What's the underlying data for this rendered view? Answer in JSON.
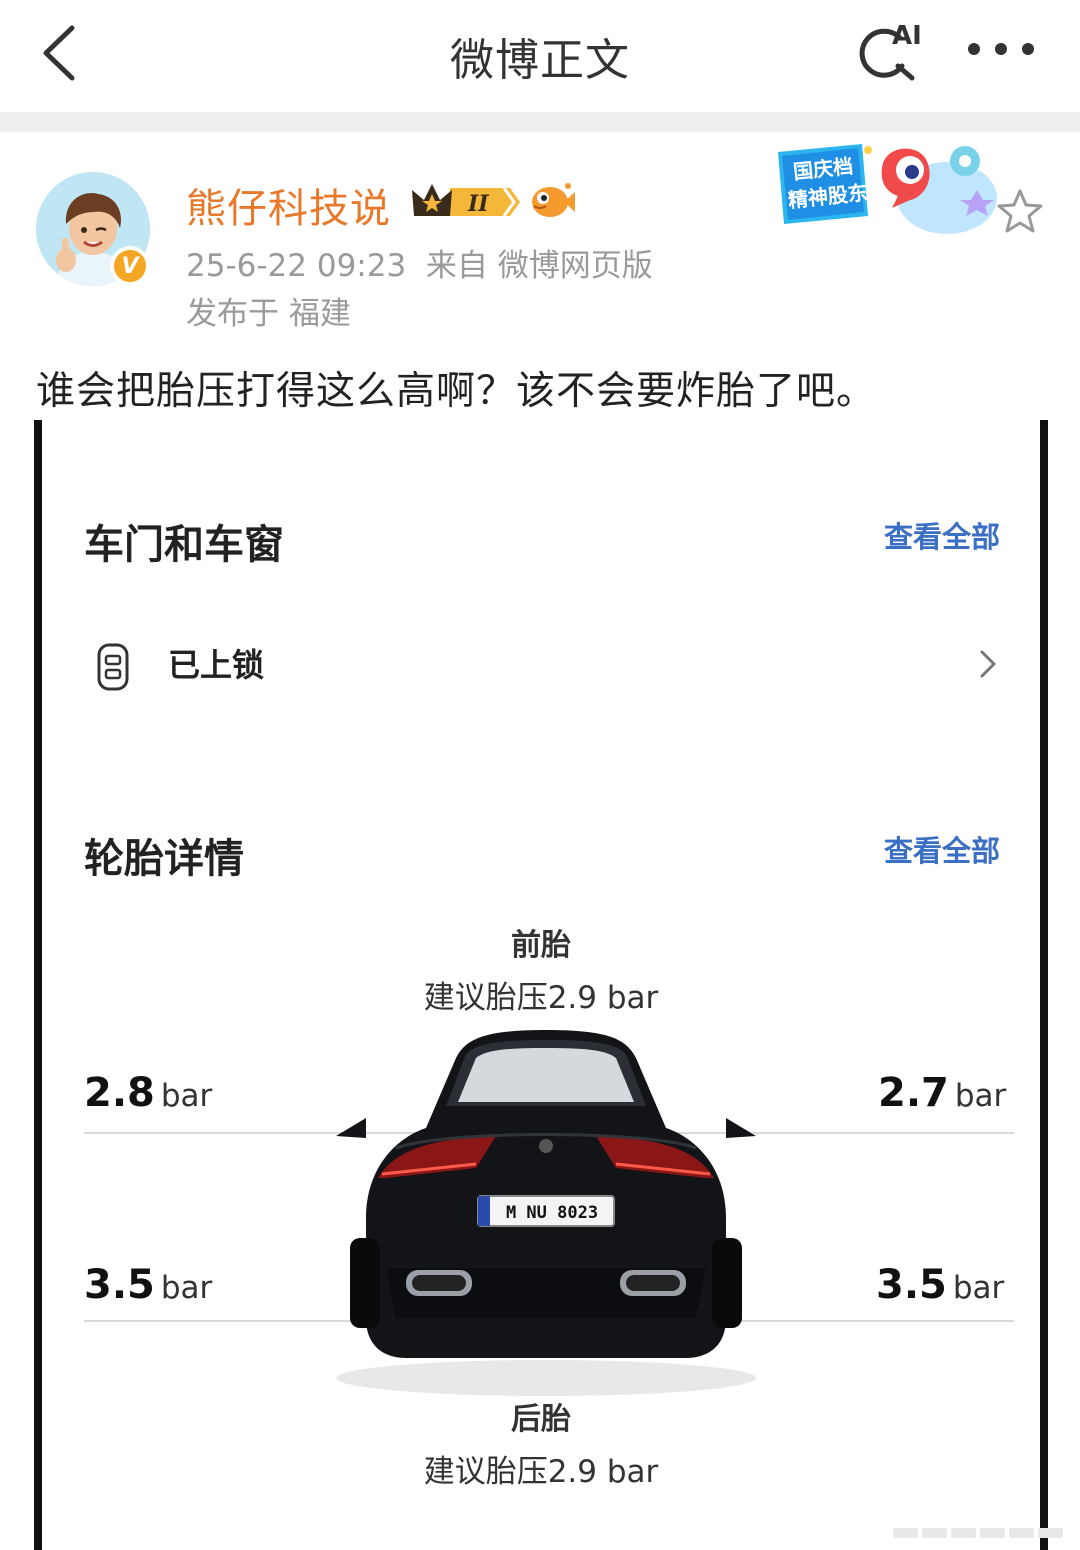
{
  "nav": {
    "title": "微博正文",
    "ai_label": "AI"
  },
  "post": {
    "author": "熊仔科技说",
    "badge_level": "II",
    "verified_mark": "V",
    "time": "25-6-22 09:23",
    "source": "来自 微博网页版",
    "location": "发布于 福建",
    "promo_text": [
      "国庆档",
      "精神股东"
    ],
    "text": "谁会把胎压打得这么高啊？该不会要炸胎了吧。"
  },
  "screenshot": {
    "doors_title": "车门和车窗",
    "view_all_1": "查看全部",
    "lock_status": "已上锁",
    "tires_title": "轮胎详情",
    "view_all_2": "查看全部",
    "front_label": "前胎",
    "front_recommended": "建议胎压2.9 bar",
    "rear_label": "后胎",
    "rear_recommended": "建议胎压2.9 bar",
    "unit": "bar",
    "front_left": "2.8",
    "front_right": "2.7",
    "rear_left": "3.5",
    "rear_right": "3.5",
    "plate": "M NU 8023"
  },
  "colors": {
    "author": "#e8782a",
    "link_blue": "#3a6fc4",
    "meta_gray": "#9a9a9a"
  }
}
